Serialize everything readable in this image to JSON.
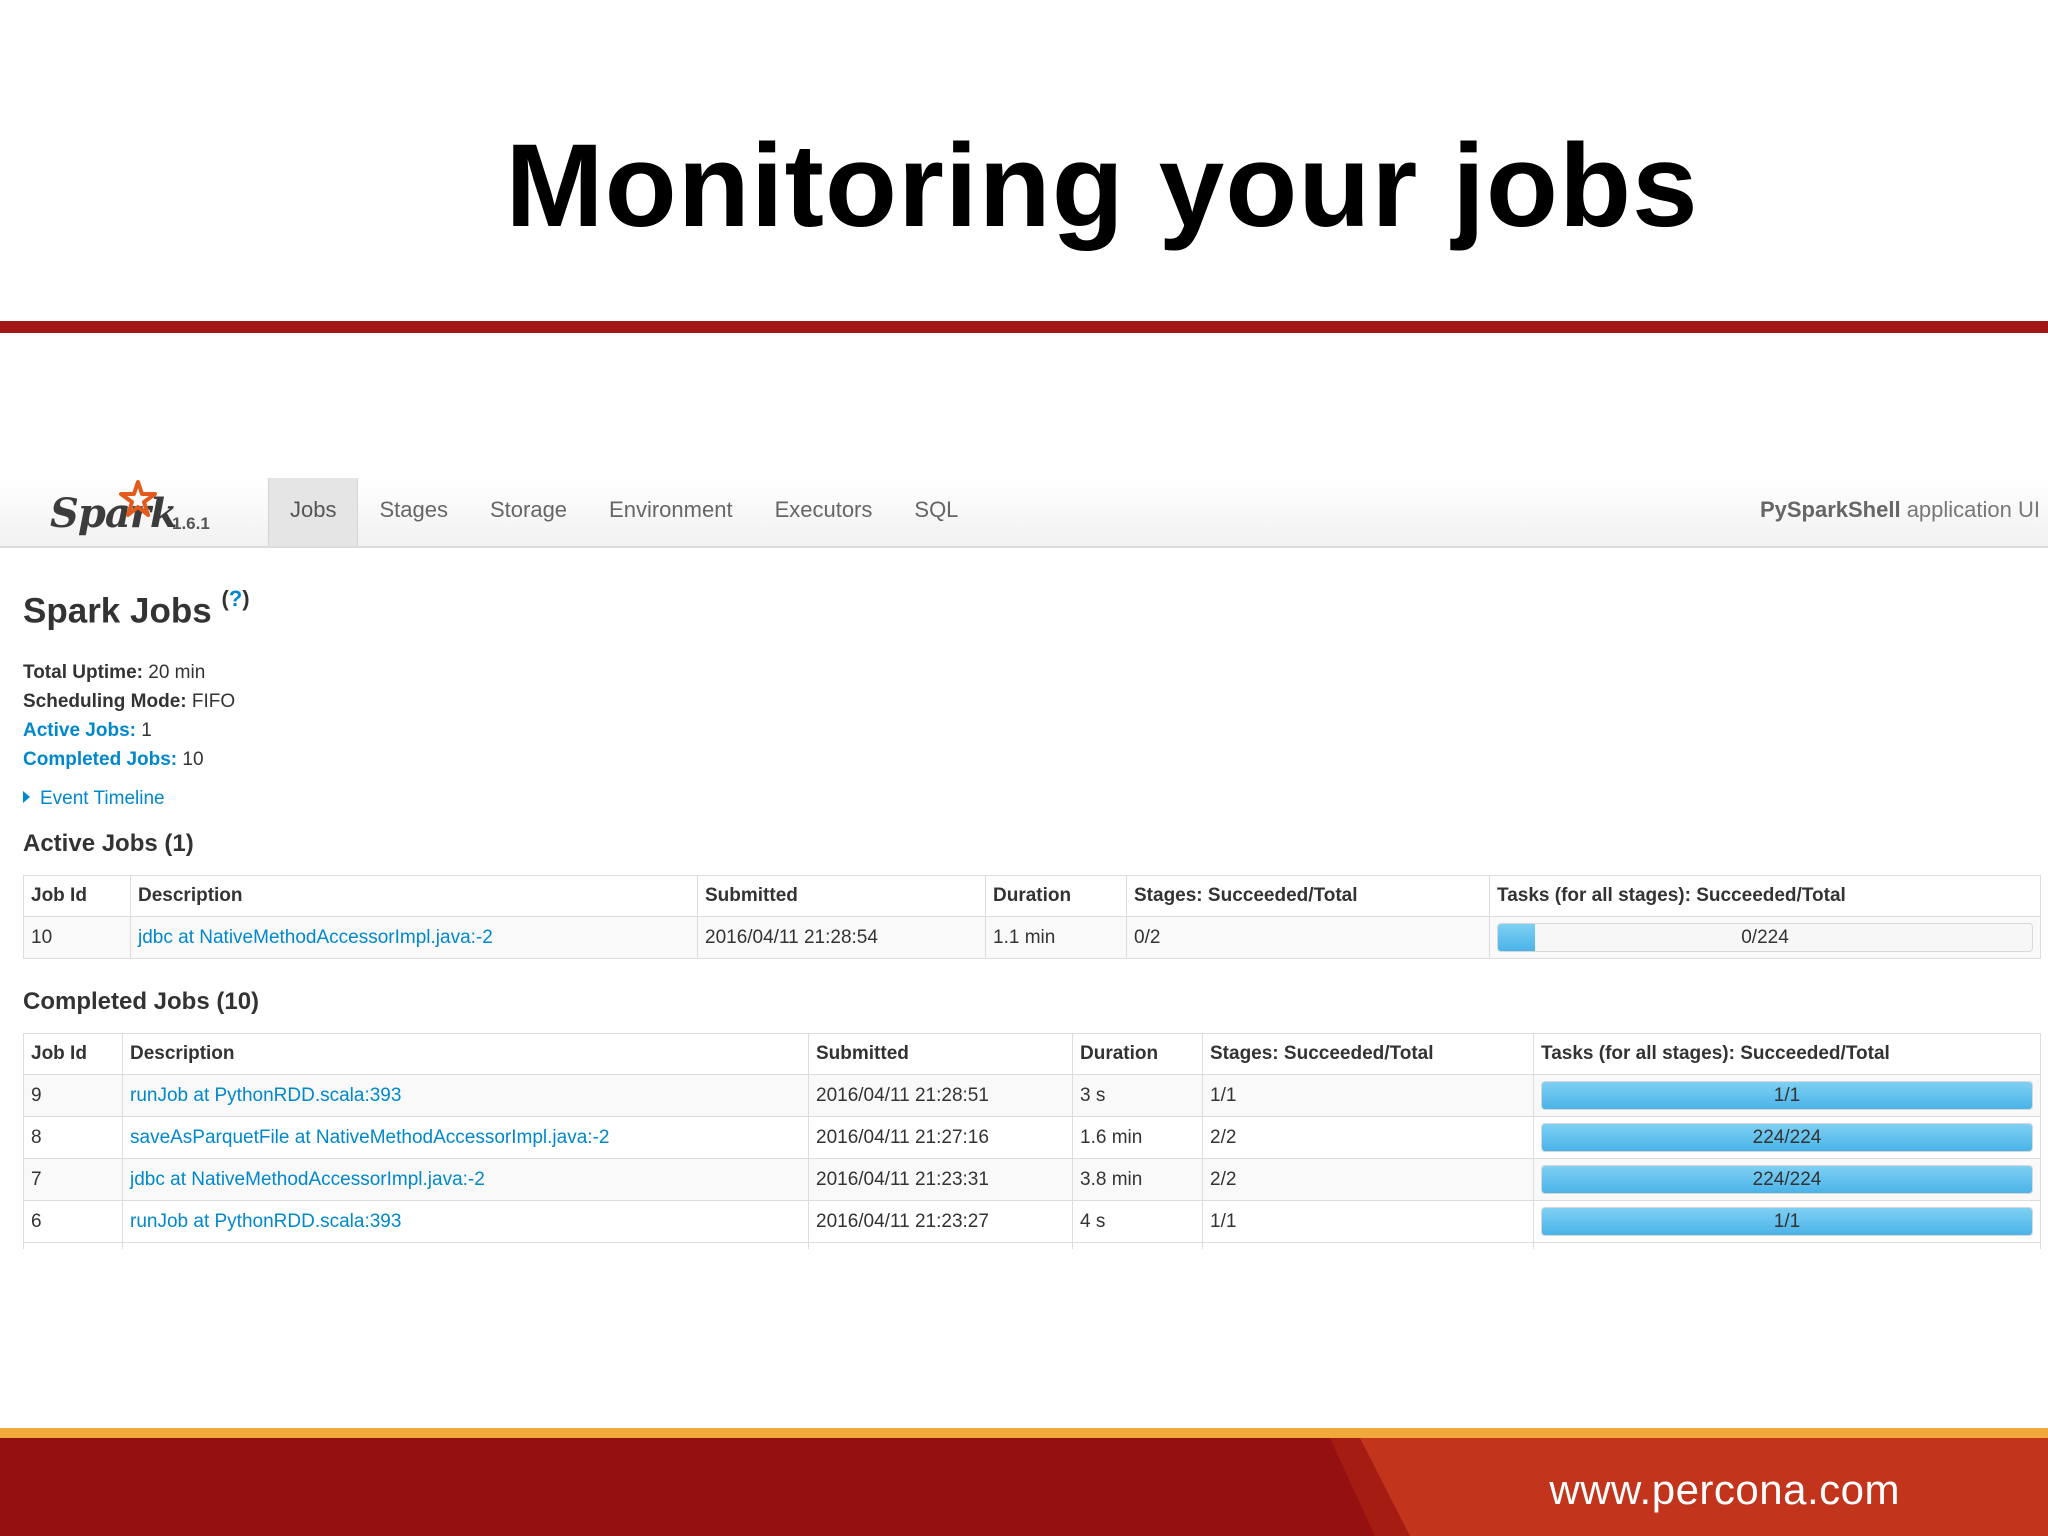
{
  "slide": {
    "title": "Monitoring your jobs",
    "footer_url": "www.percona.com"
  },
  "spark_ui": {
    "brand": "Spark",
    "version": "1.6.1",
    "tabs": [
      {
        "label": "Jobs",
        "active": true
      },
      {
        "label": "Stages",
        "active": false
      },
      {
        "label": "Storage",
        "active": false
      },
      {
        "label": "Environment",
        "active": false
      },
      {
        "label": "Executors",
        "active": false
      },
      {
        "label": "SQL",
        "active": false
      }
    ],
    "app_name": "PySparkShell",
    "app_suffix": " application UI",
    "page_title": "Spark Jobs",
    "help": "?",
    "summary": {
      "uptime_label": "Total Uptime:",
      "uptime_value": " 20 min",
      "mode_label": "Scheduling Mode:",
      "mode_value": " FIFO",
      "active_label": "Active Jobs:",
      "active_value": " 1",
      "completed_label": "Completed Jobs:",
      "completed_value": " 10"
    },
    "event_timeline": "Event Timeline",
    "active_jobs": {
      "heading": "Active Jobs (1)",
      "columns": [
        "Job Id",
        "Description",
        "Submitted",
        "Duration",
        "Stages: Succeeded/Total",
        "Tasks (for all stages): Succeeded/Total"
      ],
      "rows": [
        {
          "id": "10",
          "description": "jdbc at NativeMethodAccessorImpl.java:-2",
          "submitted": "2016/04/11 21:28:54",
          "duration": "1.1 min",
          "stages": "0/2",
          "tasks": "0/224",
          "progress": 0.07
        }
      ]
    },
    "completed_jobs": {
      "heading": "Completed Jobs (10)",
      "columns": [
        "Job Id",
        "Description",
        "Submitted",
        "Duration",
        "Stages: Succeeded/Total",
        "Tasks (for all stages): Succeeded/Total"
      ],
      "rows": [
        {
          "id": "9",
          "description": "runJob at PythonRDD.scala:393",
          "submitted": "2016/04/11 21:28:51",
          "duration": "3 s",
          "stages": "1/1",
          "tasks": "1/1",
          "progress": 1.0
        },
        {
          "id": "8",
          "description": "saveAsParquetFile at NativeMethodAccessorImpl.java:-2",
          "submitted": "2016/04/11 21:27:16",
          "duration": "1.6 min",
          "stages": "2/2",
          "tasks": "224/224",
          "progress": 1.0
        },
        {
          "id": "7",
          "description": "jdbc at NativeMethodAccessorImpl.java:-2",
          "submitted": "2016/04/11 21:23:31",
          "duration": "3.8 min",
          "stages": "2/2",
          "tasks": "224/224",
          "progress": 1.0
        },
        {
          "id": "6",
          "description": "runJob at PythonRDD.scala:393",
          "submitted": "2016/04/11 21:23:27",
          "duration": "4 s",
          "stages": "1/1",
          "tasks": "1/1",
          "progress": 1.0
        }
      ]
    }
  },
  "colors": {
    "link": "#0088cc",
    "title_rule": "#a31719",
    "footer_red": "#951010",
    "footer_orange": "#f2a93b",
    "progress_fill": "#4ab3e8"
  }
}
